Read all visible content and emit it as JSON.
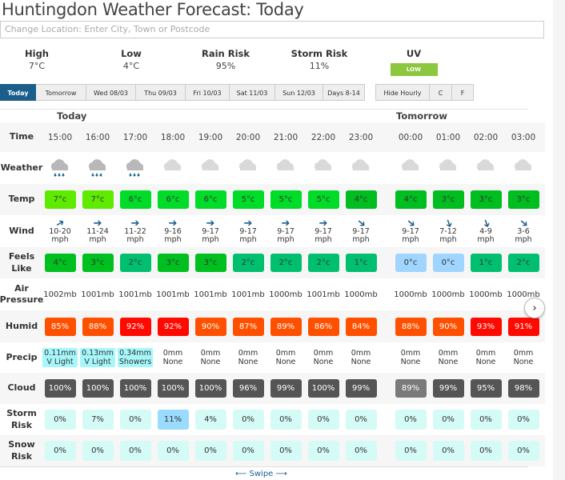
{
  "page_title": "Huntingdon Weather Forecast: Today",
  "location_input": {
    "placeholder": "Change Location: Enter City, Town or Postcode",
    "value": ""
  },
  "summary": {
    "high": {
      "label": "High",
      "value": "7°C"
    },
    "low": {
      "label": "Low",
      "value": "4°C"
    },
    "rain_risk": {
      "label": "Rain Risk",
      "value": "95%"
    },
    "storm_risk": {
      "label": "Storm Risk",
      "value": "11%"
    },
    "uv": {
      "label": "UV",
      "value": "LOW",
      "color": "#8dc63f"
    }
  },
  "tabs": [
    {
      "label": "Today",
      "active": true
    },
    {
      "label": "Tomorrow"
    },
    {
      "label": "Wed 08/03"
    },
    {
      "label": "Thu 09/03"
    },
    {
      "label": "Fri 10/03"
    },
    {
      "label": "Sat 11/03"
    },
    {
      "label": "Sun 12/03"
    },
    {
      "label": "Days 8-14"
    }
  ],
  "options": [
    {
      "label": "Hide Hourly"
    },
    {
      "label": "C"
    },
    {
      "label": "F"
    }
  ],
  "day_groups": [
    "Today",
    "Tomorrow"
  ],
  "row_labels": {
    "time": "Time",
    "weather": "Weather",
    "temp": "Temp",
    "wind": "Wind",
    "feels": "Feels Like",
    "pressure": "Air Pressure",
    "humid": "Humid",
    "precip": "Precip",
    "cloud": "Cloud",
    "storm": "Storm Risk",
    "snow": "Snow Risk"
  },
  "hours": [
    {
      "time": "15:00",
      "weather": "rain-cloud",
      "temp": "7°c",
      "temp_color": "#5eeb00",
      "wind_dir": "up-right",
      "wind": "10-20",
      "wind_unit": "mph",
      "feels": "4°c",
      "feels_color": "#00c020",
      "pressure": "1002mb",
      "humid": "85%",
      "humid_color": "#ff5000",
      "precip_amt": "0.11mm",
      "precip_desc": "V Light",
      "precip_highlight": true,
      "cloud": "100%",
      "cloud_color": "#555555",
      "storm": "0%",
      "storm_color": "#d5fbf6",
      "snow": "0%"
    },
    {
      "time": "16:00",
      "weather": "rain-cloud",
      "temp": "7°c",
      "temp_color": "#5eeb00",
      "wind_dir": "right",
      "wind": "11-24",
      "wind_unit": "mph",
      "feels": "3°c",
      "feels_color": "#00c020",
      "pressure": "1001mb",
      "humid": "88%",
      "humid_color": "#ff5000",
      "precip_amt": "0.13mm",
      "precip_desc": "V Light",
      "precip_highlight": true,
      "cloud": "100%",
      "cloud_color": "#555555",
      "storm": "7%",
      "storm_color": "#d5fbf6",
      "snow": "0%"
    },
    {
      "time": "17:00",
      "weather": "rain-cloud",
      "temp": "6°c",
      "temp_color": "#00dc28",
      "wind_dir": "right",
      "wind": "11-22",
      "wind_unit": "mph",
      "feels": "2°c",
      "feels_color": "#00c070",
      "pressure": "1001mb",
      "humid": "92%",
      "humid_color": "#ff0a00",
      "precip_amt": "0.34mm",
      "precip_desc": "Showers",
      "precip_highlight": true,
      "cloud": "100%",
      "cloud_color": "#555555",
      "storm": "0%",
      "storm_color": "#d5fbf6",
      "snow": "0%"
    },
    {
      "time": "18:00",
      "weather": "cloud",
      "temp": "6°c",
      "temp_color": "#00dc28",
      "wind_dir": "right",
      "wind": "9-16",
      "wind_unit": "mph",
      "feels": "3°c",
      "feels_color": "#00c020",
      "pressure": "1001mb",
      "humid": "92%",
      "humid_color": "#ff0a00",
      "precip_amt": "0mm",
      "precip_desc": "None",
      "precip_highlight": false,
      "cloud": "100%",
      "cloud_color": "#555555",
      "storm": "11%",
      "storm_color": "#99dcff",
      "snow": "0%"
    },
    {
      "time": "19:00",
      "weather": "cloud",
      "temp": "6°c",
      "temp_color": "#00dc28",
      "wind_dir": "right",
      "wind": "9-17",
      "wind_unit": "mph",
      "feels": "3°c",
      "feels_color": "#00c020",
      "pressure": "1001mb",
      "humid": "90%",
      "humid_color": "#ff5000",
      "precip_amt": "0mm",
      "precip_desc": "None",
      "precip_highlight": false,
      "cloud": "100%",
      "cloud_color": "#555555",
      "storm": "4%",
      "storm_color": "#d5fbf6",
      "snow": "0%"
    },
    {
      "time": "20:00",
      "weather": "cloud",
      "temp": "5°c",
      "temp_color": "#00dc28",
      "wind_dir": "right",
      "wind": "9-17",
      "wind_unit": "mph",
      "feels": "2°c",
      "feels_color": "#00c070",
      "pressure": "1001mb",
      "humid": "87%",
      "humid_color": "#ff5000",
      "precip_amt": "0mm",
      "precip_desc": "None",
      "precip_highlight": false,
      "cloud": "96%",
      "cloud_color": "#555555",
      "storm": "0%",
      "storm_color": "#d5fbf6",
      "snow": "0%"
    },
    {
      "time": "21:00",
      "weather": "cloud",
      "temp": "5°c",
      "temp_color": "#00dc28",
      "wind_dir": "right",
      "wind": "9-17",
      "wind_unit": "mph",
      "feels": "2°c",
      "feels_color": "#00c070",
      "pressure": "1000mb",
      "humid": "89%",
      "humid_color": "#ff5000",
      "precip_amt": "0mm",
      "precip_desc": "None",
      "precip_highlight": false,
      "cloud": "99%",
      "cloud_color": "#555555",
      "storm": "0%",
      "storm_color": "#d5fbf6",
      "snow": "0%"
    },
    {
      "time": "22:00",
      "weather": "cloud",
      "temp": "5°c",
      "temp_color": "#00dc28",
      "wind_dir": "right",
      "wind": "9-17",
      "wind_unit": "mph",
      "feels": "2°c",
      "feels_color": "#00c070",
      "pressure": "1001mb",
      "humid": "86%",
      "humid_color": "#ff5000",
      "precip_amt": "0mm",
      "precip_desc": "None",
      "precip_highlight": false,
      "cloud": "100%",
      "cloud_color": "#555555",
      "storm": "0%",
      "storm_color": "#d5fbf6",
      "snow": "0%"
    },
    {
      "time": "23:00",
      "weather": "cloud",
      "temp": "4°c",
      "temp_color": "#00bd20",
      "wind_dir": "down-right",
      "wind": "9-17",
      "wind_unit": "mph",
      "feels": "1°c",
      "feels_color": "#00c070",
      "pressure": "1000mb",
      "humid": "84%",
      "humid_color": "#ff5000",
      "precip_amt": "0mm",
      "precip_desc": "None",
      "precip_highlight": false,
      "cloud": "99%",
      "cloud_color": "#555555",
      "storm": "0%",
      "storm_color": "#d5fbf6",
      "snow": "0%"
    },
    {
      "time": "00:00",
      "weather": "cloud",
      "temp": "4°c",
      "temp_color": "#00bd20",
      "wind_dir": "down-right",
      "wind": "9-17",
      "wind_unit": "mph",
      "feels": "0°c",
      "feels_color": "#9fd5ff",
      "pressure": "1000mb",
      "humid": "88%",
      "humid_color": "#ff5000",
      "precip_amt": "0mm",
      "precip_desc": "None",
      "precip_highlight": false,
      "cloud": "89%",
      "cloud_color": "#7a7a7a",
      "storm": "0%",
      "storm_color": "#d5fbf6",
      "snow": "0%"
    },
    {
      "time": "01:00",
      "weather": "cloud",
      "temp": "3°c",
      "temp_color": "#00bd20",
      "wind_dir": "down",
      "wind": "7-12",
      "wind_unit": "mph",
      "feels": "0°c",
      "feels_color": "#9fd5ff",
      "pressure": "1000mb",
      "humid": "90%",
      "humid_color": "#ff5000",
      "precip_amt": "0mm",
      "precip_desc": "None",
      "precip_highlight": false,
      "cloud": "99%",
      "cloud_color": "#555555",
      "storm": "0%",
      "storm_color": "#d5fbf6",
      "snow": "0%"
    },
    {
      "time": "02:00",
      "weather": "cloud",
      "temp": "3°c",
      "temp_color": "#00bd20",
      "wind_dir": "down",
      "wind": "4-9",
      "wind_unit": "mph",
      "feels": "1°c",
      "feels_color": "#00c070",
      "pressure": "1000mb",
      "humid": "93%",
      "humid_color": "#ff0a00",
      "precip_amt": "0mm",
      "precip_desc": "None",
      "precip_highlight": false,
      "cloud": "95%",
      "cloud_color": "#555555",
      "storm": "0%",
      "storm_color": "#d5fbf6",
      "snow": "0%"
    },
    {
      "time": "03:00",
      "weather": "cloud",
      "temp": "3°c",
      "temp_color": "#00bd20",
      "wind_dir": "down-right",
      "wind": "3-6",
      "wind_unit": "mph",
      "feels": "2°c",
      "feels_color": "#00c070",
      "pressure": "1000mb",
      "humid": "91%",
      "humid_color": "#ff0a00",
      "precip_amt": "0mm",
      "precip_desc": "None",
      "precip_highlight": false,
      "cloud": "98%",
      "cloud_color": "#555555",
      "storm": "0%",
      "storm_color": "#d5fbf6",
      "snow": "0%"
    }
  ],
  "precip_highlight_color": "#a6f7fb",
  "snow_color": "#d5fbf6",
  "next_button": "›",
  "swipe_label": "Swipe"
}
